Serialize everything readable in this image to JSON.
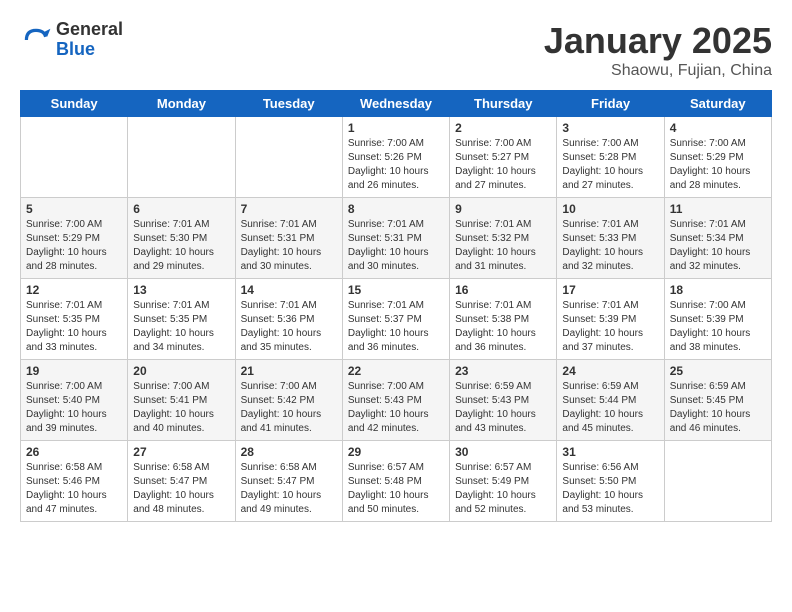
{
  "header": {
    "logo_general": "General",
    "logo_blue": "Blue",
    "title": "January 2025",
    "subtitle": "Shaowu, Fujian, China"
  },
  "days_of_week": [
    "Sunday",
    "Monday",
    "Tuesday",
    "Wednesday",
    "Thursday",
    "Friday",
    "Saturday"
  ],
  "weeks": [
    [
      {
        "day": "",
        "empty": true
      },
      {
        "day": "",
        "empty": true
      },
      {
        "day": "",
        "empty": true
      },
      {
        "day": "1",
        "sunrise": "7:00 AM",
        "sunset": "5:26 PM",
        "daylight": "10 hours and 26 minutes."
      },
      {
        "day": "2",
        "sunrise": "7:00 AM",
        "sunset": "5:27 PM",
        "daylight": "10 hours and 27 minutes."
      },
      {
        "day": "3",
        "sunrise": "7:00 AM",
        "sunset": "5:28 PM",
        "daylight": "10 hours and 27 minutes."
      },
      {
        "day": "4",
        "sunrise": "7:00 AM",
        "sunset": "5:29 PM",
        "daylight": "10 hours and 28 minutes."
      }
    ],
    [
      {
        "day": "5",
        "sunrise": "7:00 AM",
        "sunset": "5:29 PM",
        "daylight": "10 hours and 28 minutes."
      },
      {
        "day": "6",
        "sunrise": "7:01 AM",
        "sunset": "5:30 PM",
        "daylight": "10 hours and 29 minutes."
      },
      {
        "day": "7",
        "sunrise": "7:01 AM",
        "sunset": "5:31 PM",
        "daylight": "10 hours and 30 minutes."
      },
      {
        "day": "8",
        "sunrise": "7:01 AM",
        "sunset": "5:31 PM",
        "daylight": "10 hours and 30 minutes."
      },
      {
        "day": "9",
        "sunrise": "7:01 AM",
        "sunset": "5:32 PM",
        "daylight": "10 hours and 31 minutes."
      },
      {
        "day": "10",
        "sunrise": "7:01 AM",
        "sunset": "5:33 PM",
        "daylight": "10 hours and 32 minutes."
      },
      {
        "day": "11",
        "sunrise": "7:01 AM",
        "sunset": "5:34 PM",
        "daylight": "10 hours and 32 minutes."
      }
    ],
    [
      {
        "day": "12",
        "sunrise": "7:01 AM",
        "sunset": "5:35 PM",
        "daylight": "10 hours and 33 minutes."
      },
      {
        "day": "13",
        "sunrise": "7:01 AM",
        "sunset": "5:35 PM",
        "daylight": "10 hours and 34 minutes."
      },
      {
        "day": "14",
        "sunrise": "7:01 AM",
        "sunset": "5:36 PM",
        "daylight": "10 hours and 35 minutes."
      },
      {
        "day": "15",
        "sunrise": "7:01 AM",
        "sunset": "5:37 PM",
        "daylight": "10 hours and 36 minutes."
      },
      {
        "day": "16",
        "sunrise": "7:01 AM",
        "sunset": "5:38 PM",
        "daylight": "10 hours and 36 minutes."
      },
      {
        "day": "17",
        "sunrise": "7:01 AM",
        "sunset": "5:39 PM",
        "daylight": "10 hours and 37 minutes."
      },
      {
        "day": "18",
        "sunrise": "7:00 AM",
        "sunset": "5:39 PM",
        "daylight": "10 hours and 38 minutes."
      }
    ],
    [
      {
        "day": "19",
        "sunrise": "7:00 AM",
        "sunset": "5:40 PM",
        "daylight": "10 hours and 39 minutes."
      },
      {
        "day": "20",
        "sunrise": "7:00 AM",
        "sunset": "5:41 PM",
        "daylight": "10 hours and 40 minutes."
      },
      {
        "day": "21",
        "sunrise": "7:00 AM",
        "sunset": "5:42 PM",
        "daylight": "10 hours and 41 minutes."
      },
      {
        "day": "22",
        "sunrise": "7:00 AM",
        "sunset": "5:43 PM",
        "daylight": "10 hours and 42 minutes."
      },
      {
        "day": "23",
        "sunrise": "6:59 AM",
        "sunset": "5:43 PM",
        "daylight": "10 hours and 43 minutes."
      },
      {
        "day": "24",
        "sunrise": "6:59 AM",
        "sunset": "5:44 PM",
        "daylight": "10 hours and 45 minutes."
      },
      {
        "day": "25",
        "sunrise": "6:59 AM",
        "sunset": "5:45 PM",
        "daylight": "10 hours and 46 minutes."
      }
    ],
    [
      {
        "day": "26",
        "sunrise": "6:58 AM",
        "sunset": "5:46 PM",
        "daylight": "10 hours and 47 minutes."
      },
      {
        "day": "27",
        "sunrise": "6:58 AM",
        "sunset": "5:47 PM",
        "daylight": "10 hours and 48 minutes."
      },
      {
        "day": "28",
        "sunrise": "6:58 AM",
        "sunset": "5:47 PM",
        "daylight": "10 hours and 49 minutes."
      },
      {
        "day": "29",
        "sunrise": "6:57 AM",
        "sunset": "5:48 PM",
        "daylight": "10 hours and 50 minutes."
      },
      {
        "day": "30",
        "sunrise": "6:57 AM",
        "sunset": "5:49 PM",
        "daylight": "10 hours and 52 minutes."
      },
      {
        "day": "31",
        "sunrise": "6:56 AM",
        "sunset": "5:50 PM",
        "daylight": "10 hours and 53 minutes."
      },
      {
        "day": "",
        "empty": true
      }
    ]
  ],
  "labels": {
    "sunrise": "Sunrise:",
    "sunset": "Sunset:",
    "daylight": "Daylight:"
  }
}
